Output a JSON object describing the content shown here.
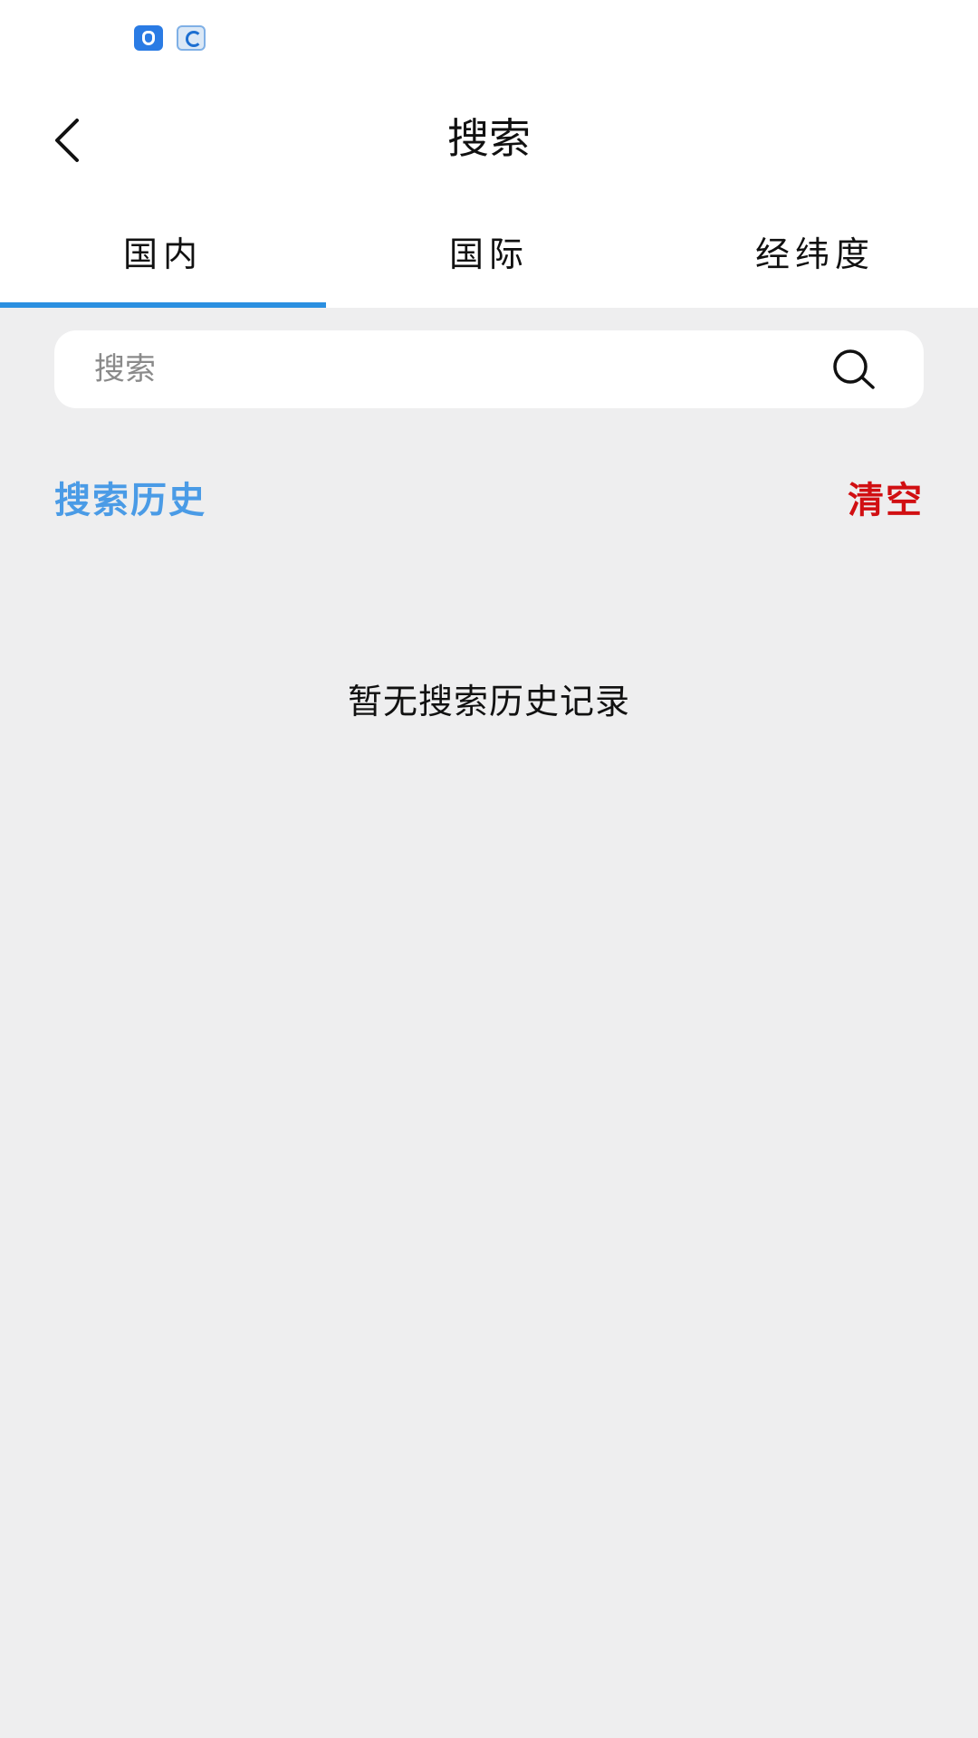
{
  "status_bar": {
    "notification_icons": [
      "app-notification-icon",
      "browser-notification-icon"
    ]
  },
  "header": {
    "title": "搜索",
    "back_icon": "chevron-left-icon"
  },
  "tabs": [
    {
      "label": "国内",
      "selected": true
    },
    {
      "label": "国际",
      "selected": false
    },
    {
      "label": "经纬度",
      "selected": false
    }
  ],
  "colors": {
    "accent": "#2b8fe0",
    "history_title": "#4a9be6",
    "clear": "#d10f12",
    "background": "#eeeeef"
  },
  "search": {
    "placeholder": "搜索",
    "value": "",
    "icon": "search-icon"
  },
  "history": {
    "title": "搜索历史",
    "clear_label": "清空",
    "empty_message": "暂无搜索历史记录"
  }
}
